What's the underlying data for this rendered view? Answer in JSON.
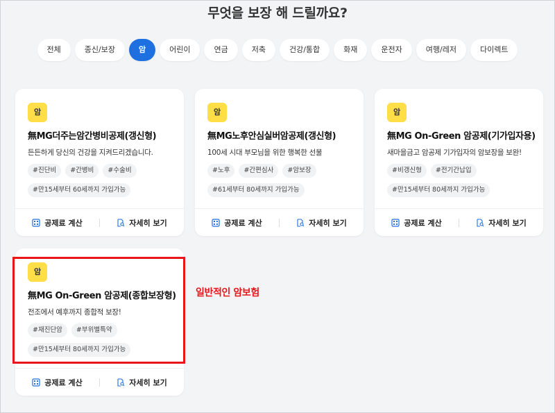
{
  "heading": "무엇을 보장 해 드릴까요?",
  "tabs": [
    {
      "label": "전체",
      "active": false
    },
    {
      "label": "종신/보장",
      "active": false
    },
    {
      "label": "암",
      "active": true
    },
    {
      "label": "어린이",
      "active": false
    },
    {
      "label": "연금",
      "active": false
    },
    {
      "label": "저축",
      "active": false
    },
    {
      "label": "건강/통합",
      "active": false
    },
    {
      "label": "화재",
      "active": false
    },
    {
      "label": "운전자",
      "active": false
    },
    {
      "label": "여행/레저",
      "active": false
    },
    {
      "label": "다이렉트",
      "active": false
    }
  ],
  "cards": [
    {
      "badge": "암",
      "title": "無MG더주는암간병비공제(갱신형)",
      "desc": "든든하게 당신의 건강을 지켜드리겠습니다.",
      "tags": [
        "#진단비",
        "#간병비",
        "#수술비",
        "#만15세부터 60세까지 가입가능"
      ],
      "calc_label": "공제료 계산",
      "detail_label": "자세히 보기"
    },
    {
      "badge": "암",
      "title": "無MG노후안심실버암공제(갱신형)",
      "desc": "100세 시대 부모님을 위한 행복한 선물",
      "tags": [
        "#노후",
        "#간편심사",
        "#암보장",
        "#61세부터 80세까지 가입가능"
      ],
      "calc_label": "공제료 계산",
      "detail_label": "자세히 보기"
    },
    {
      "badge": "암",
      "title": "無MG On-Green 암공제(기가입자용)",
      "desc": "새마을금고 암공제 기가입자의 암보장을 보완!",
      "tags": [
        "#비갱신형",
        "#전기간납입",
        "#만15세부터 80세까지 가입가능"
      ],
      "calc_label": "공제료 계산",
      "detail_label": "자세히 보기"
    },
    {
      "badge": "암",
      "title": "無MG On-Green 암공제(종합보장형)",
      "desc": "전조에서 예후까지 종합적 보장!",
      "tags": [
        "#재진단암",
        "#부위별특약",
        "#만15세부터 80세까지 가입가능"
      ],
      "calc_label": "공제료 계산",
      "detail_label": "자세히 보기"
    }
  ],
  "annotation": "일반적인 암보험",
  "colors": {
    "accent": "#1e6fe0",
    "badge": "#ffde47",
    "highlight": "#e8161b"
  },
  "icons": {
    "calc": "calculator-icon",
    "detail": "document-search-icon"
  }
}
